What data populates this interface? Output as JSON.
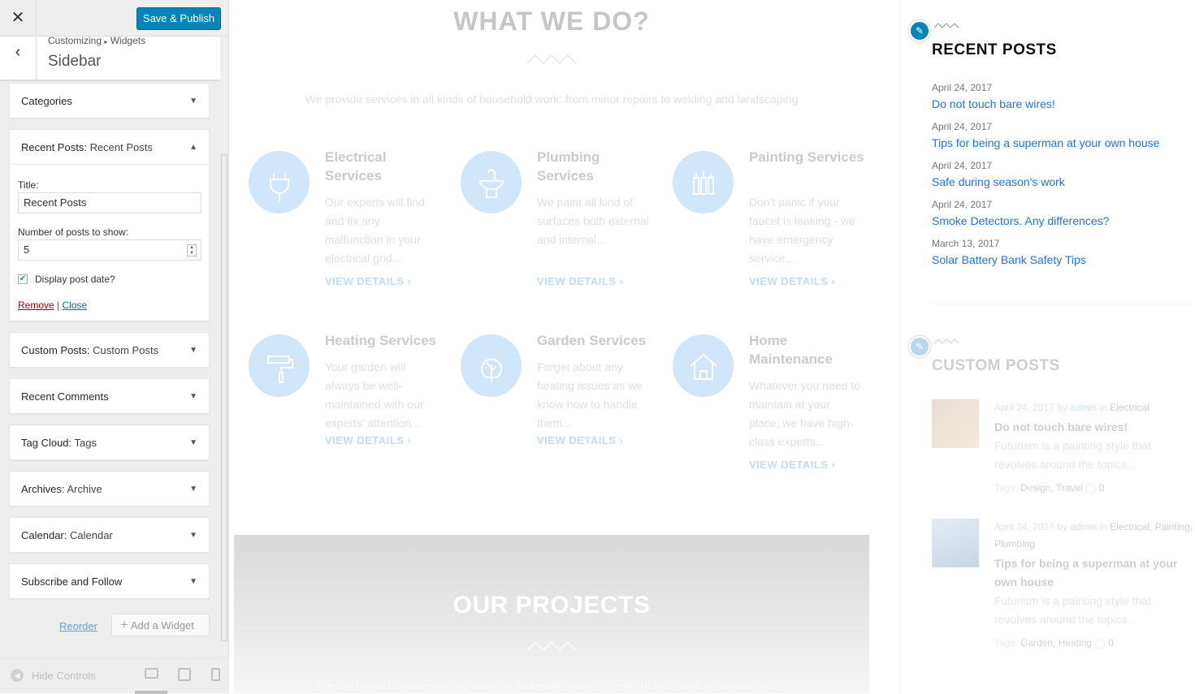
{
  "panel": {
    "close_icon": "close-icon",
    "publish_label": "Save & Publish",
    "breadcrumb": {
      "parent": "Customizing",
      "separator": "▸",
      "current": "Widgets"
    },
    "section_title": "Sidebar",
    "widgets": [
      {
        "name": "Categories",
        "subtitle": "",
        "expanded": false
      },
      {
        "name": "Recent Posts:",
        "subtitle": "Recent Posts",
        "expanded": true
      },
      {
        "name": "Custom Posts:",
        "subtitle": "Custom Posts",
        "expanded": false
      },
      {
        "name": "Recent Comments",
        "subtitle": "",
        "expanded": false
      },
      {
        "name": "Tag Cloud:",
        "subtitle": "Tags",
        "expanded": false
      },
      {
        "name": "Archives:",
        "subtitle": "Archive",
        "expanded": false
      },
      {
        "name": "Calendar:",
        "subtitle": "Calendar",
        "expanded": false
      },
      {
        "name": "Subscribe and Follow",
        "subtitle": "",
        "expanded": false
      }
    ],
    "form": {
      "title_label": "Title:",
      "title_value": "Recent Posts",
      "count_label": "Number of posts to show:",
      "count_value": "5",
      "date_label": "Display post date?",
      "date_checked": true,
      "remove": "Remove",
      "sep": "|",
      "close": "Close"
    },
    "reorder": "Reorder",
    "add_widget": "Add a Widget",
    "hide_controls": "Hide Controls",
    "accent": "#0085ba"
  },
  "preview": {
    "heading": "WHAT WE DO?",
    "intro": "We provide services in all kinds of household work: from minor repairs to welding and landscaping",
    "services": [
      {
        "title": "Electrical Services",
        "desc": "Our experts will find and fix any malfunction in your electrical grid...",
        "link": "VIEW DETAILS",
        "icon": "plug-icon"
      },
      {
        "title": "Plumbing Services",
        "desc": "We paint all kind of surfaces both external and internal...",
        "link": "VIEW DETAILS",
        "icon": "sink-icon"
      },
      {
        "title": "Painting Services",
        "desc": "Don't panic if your faucet is leaking - we have emergency service...",
        "link": "VIEW DETAILS",
        "icon": "paint-icon"
      },
      {
        "title": "Heating Services",
        "desc": "Your garden will always be well-maintained with our experts' attention...",
        "link": "VIEW DETAILS",
        "icon": "paint-roller-icon"
      },
      {
        "title": "Garden Services",
        "desc": "Forget about any heating issues as we know how to handle them...",
        "link": "VIEW DETAILS",
        "icon": "tree-icon"
      },
      {
        "title": "Home Maintenance",
        "desc": "Whatever you need to maintain at your place, we have high-class experts...",
        "link": "VIEW DETAILS",
        "icon": "house-icon"
      }
    ],
    "projects_heading": "OUR PROJECTS",
    "projects_intro": "We are proud to show you our projects that were made with all our skills and professionalism.",
    "sidebar": {
      "recent_title": "RECENT POSTS",
      "recent": [
        {
          "date": "April 24, 2017",
          "title": "Do not touch bare wires!"
        },
        {
          "date": "April 24, 2017",
          "title": "Tips for being a superman at your own house"
        },
        {
          "date": "April 24, 2017",
          "title": "Safe during season's work"
        },
        {
          "date": "April 24, 2017",
          "title": "Smoke Detectors. Any differences?"
        },
        {
          "date": "March 13, 2017",
          "title": "Solar Battery Bank Safety Tips"
        }
      ],
      "custom_title": "CUSTOM POSTS",
      "custom": [
        {
          "date": "April 24, 2017",
          "by": "by",
          "author": "admin",
          "in": "in",
          "cats": "Electrical",
          "title": "Do not touch bare wires!",
          "excerpt": "Futurism is a painting style that revolves around the topics...",
          "tags_label": "Tags:",
          "tags": "Design, Travel",
          "comments": "0"
        },
        {
          "date": "April 24, 2017",
          "by": "by",
          "author": "admin",
          "in": "in",
          "cats": "Electrical, Painting, Plumbing",
          "title": "Tips for being a superman at your own house",
          "excerpt": "Futurism is a painting style that revolves around the topics...",
          "tags_label": "Tags:",
          "tags": "Garden, Heating",
          "comments": "0"
        }
      ],
      "link_color": "#1e73e8"
    }
  }
}
